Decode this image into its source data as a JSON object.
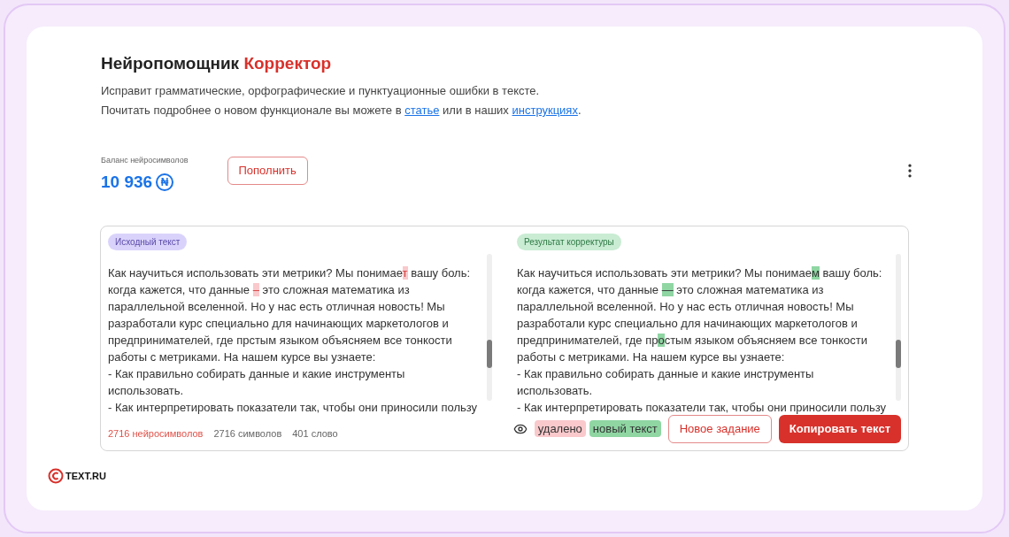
{
  "header": {
    "title": "Нейропомощник",
    "title_accent": "Корректор",
    "description": "Исправит грамматические, орфографические и пунктуационные ошибки в тексте.",
    "more_prefix": "Почитать подробнее о новом функционале вы можете в",
    "link_article": "статье",
    "more_middle": "или в наших",
    "link_instructions": "инструкциях",
    "more_suffix": "."
  },
  "balance": {
    "label": "Баланс нейросимволов",
    "value": "10 936",
    "currency": "₦",
    "topup_button": "Пополнить"
  },
  "panels": [
    {
      "badge": "Исходный текст",
      "kind": "source",
      "paragraphs": [
        [
          {
            "kind": "plain",
            "text": "Как научиться использовать эти метрики? Мы понимае"
          },
          {
            "kind": "deleted",
            "text": "т"
          },
          {
            "kind": "plain",
            "text": " вашу боль: когда кажется, что данные "
          },
          {
            "kind": "deleted",
            "text": "–"
          },
          {
            "kind": "plain",
            "text": " это сложная математика из параллельной вселенной. Но у нас есть отличная новость! Мы разработали курс специально для начинающих маркетологов и предпринимателей, где прстым языком объясняем все тонкости работы с метриками. На нашем курсе вы узнаете:"
          }
        ],
        [
          {
            "kind": "plain",
            "text": "- Как правильно собирать данные и какие инструменты использовать."
          }
        ],
        [
          {
            "kind": "plain",
            "text": "- Как интерпретировать показатели так, чтобы они приносили пользу"
          }
        ]
      ]
    },
    {
      "badge": "Результат корректуры",
      "kind": "result",
      "paragraphs": [
        [
          {
            "kind": "plain",
            "text": "Как научиться использовать эти метрики? Мы понимае"
          },
          {
            "kind": "inserted",
            "text": "м"
          },
          {
            "kind": "plain",
            "text": " вашу боль: когда кажется, что данные "
          },
          {
            "kind": "inserted",
            "text": "—"
          },
          {
            "kind": "plain",
            "text": " это сложная математика из параллельной вселенной. Но у нас есть отличная новость! Мы разработали курс специально для начинающих маркетологов и предпринимателей, где пр"
          },
          {
            "kind": "inserted",
            "text": "о"
          },
          {
            "kind": "plain",
            "text": "стым языком объясняем все тонкости работы с метриками. На нашем курсе вы узнаете:"
          }
        ],
        [
          {
            "kind": "plain",
            "text": "- Как правильно собирать данные и какие инструменты использовать."
          }
        ],
        [
          {
            "kind": "plain",
            "text": "- Как интерпретировать показатели так, чтобы они приносили пользу"
          }
        ]
      ]
    }
  ],
  "footer": {
    "neuro_count": "2716 нейросимволов",
    "char_count": "2716 символов",
    "word_count": "401 слово",
    "legend_deleted": "удалено",
    "legend_inserted": "новый текст",
    "new_task_button": "Новое задание",
    "copy_button": "Копировать текст"
  },
  "logo": {
    "text": "TEXT.RU"
  }
}
